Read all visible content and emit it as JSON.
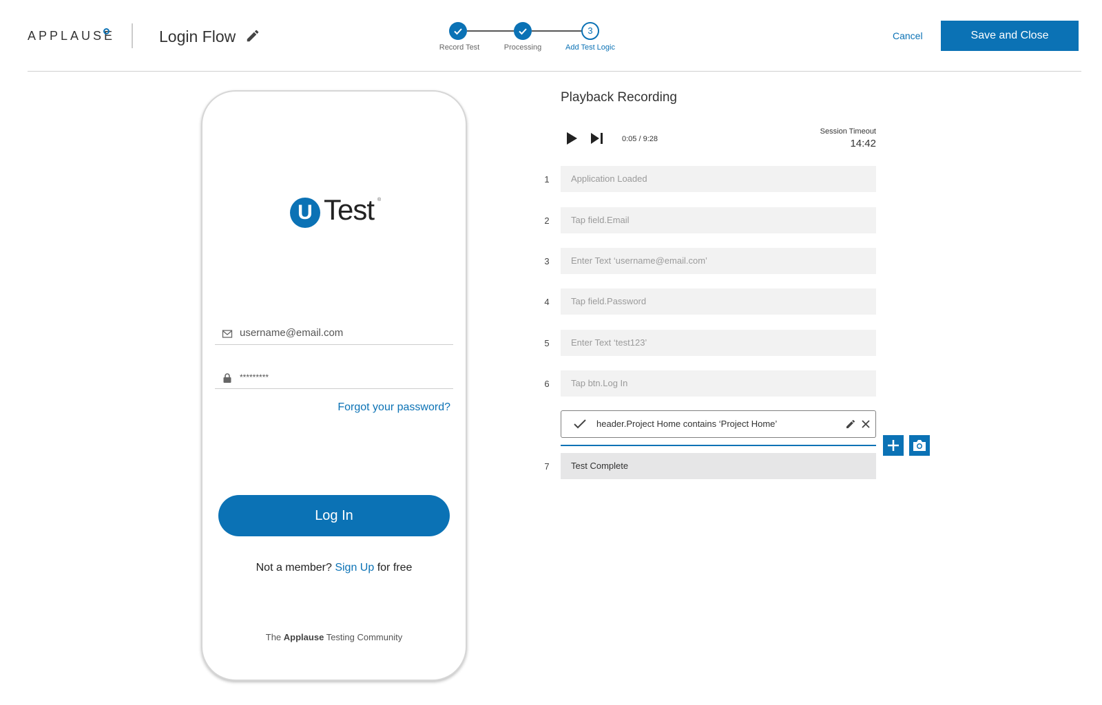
{
  "header": {
    "brand": "APPLAUSE",
    "flow_title": "Login Flow",
    "steps": [
      {
        "label": "Record Test",
        "state": "done"
      },
      {
        "label": "Processing",
        "state": "done"
      },
      {
        "label": "Add Test Logic",
        "state": "current",
        "number": "3"
      }
    ],
    "cancel_label": "Cancel",
    "save_label": "Save and Close"
  },
  "phone": {
    "logo_letter": "U",
    "logo_text": "Test",
    "logo_reg": "®",
    "email_value": "username@email.com",
    "password_value": "*********",
    "forgot_label": "Forgot your password?",
    "login_label": "Log In",
    "signup_prefix": "Not a member?",
    "signup_link": "Sign Up",
    "signup_suffix": "for free",
    "community_prefix": "The",
    "community_brand": "Applause",
    "community_suffix": "Testing Community"
  },
  "playback": {
    "title": "Playback Recording",
    "time": "0:05 / 9:28",
    "timeout_label": "Session Timeout",
    "timeout_value": "14:42",
    "steps": [
      {
        "num": "1",
        "text": "Application Loaded"
      },
      {
        "num": "2",
        "text": "Tap field.Email"
      },
      {
        "num": "3",
        "text": "Enter Text ‘username@email.com’"
      },
      {
        "num": "4",
        "text": "Tap field.Password"
      },
      {
        "num": "5",
        "text": "Enter Text ‘test123’"
      },
      {
        "num": "6",
        "text": "Tap btn.Log In"
      }
    ],
    "assertion": "header.Project Home contains ‘Project Home’",
    "final_step": {
      "num": "7",
      "text": "Test Complete"
    }
  },
  "colors": {
    "accent": "#0b72b5"
  }
}
